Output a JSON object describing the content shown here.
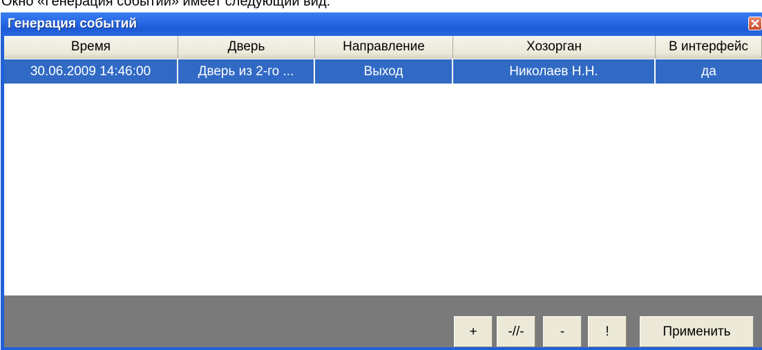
{
  "caption": "Окно «Генерация событий» имеет следующий вид:",
  "window": {
    "title": "Генерация событий"
  },
  "grid": {
    "columns": [
      "Время",
      "Дверь",
      "Направление",
      "Хозорган",
      "В интерфейс"
    ],
    "rows": [
      [
        "30.06.2009 14:46:00",
        "Дверь из 2-го ...",
        "Выход",
        "Николаев Н.Н.",
        "да"
      ]
    ],
    "selected_row": 0
  },
  "toolbar": {
    "add_label": "+",
    "edit_label": "-//-",
    "remove_label": "-",
    "exclaim_label": "!",
    "apply_label": "Применить"
  },
  "colors": {
    "titlebar": "#2160d8",
    "selection": "#316ac5",
    "toolbar_bg": "#7a7a7a",
    "button_face": "#ece9d8"
  }
}
